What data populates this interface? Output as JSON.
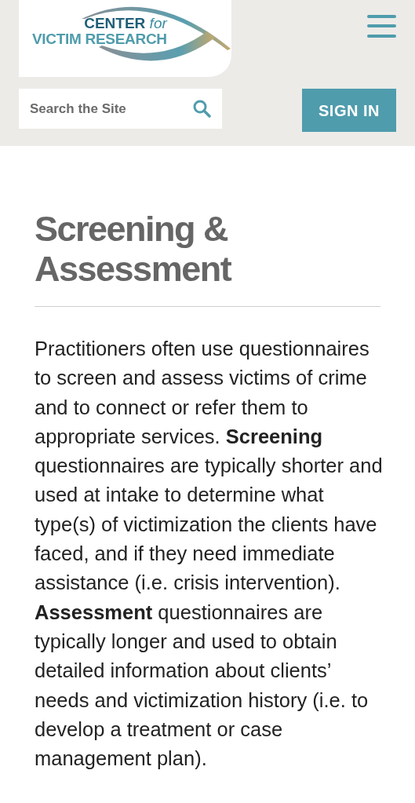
{
  "header": {
    "logo": {
      "line_1": "CENTER",
      "line_1_suffix": "for",
      "line_2": "VICTIM RESEARCH"
    },
    "search": {
      "placeholder": "Search the Site"
    },
    "sign_in": "SIGN IN"
  },
  "page": {
    "title": "Screening & Assessment",
    "body": "Practitioners often use questionnaires to screen and assess victims of crime and to connect or refer them to appropriate services. **Screening** questionnaires are typically shorter and used at intake to determine what type(s) of victimization the clients have faced, and if they need immediate assistance (i.e. crisis intervention). **Assessment** questionnaires are typically longer and used to obtain detailed information about clients’ needs and victimization history (i.e. to develop a treatment or case management plan)."
  }
}
